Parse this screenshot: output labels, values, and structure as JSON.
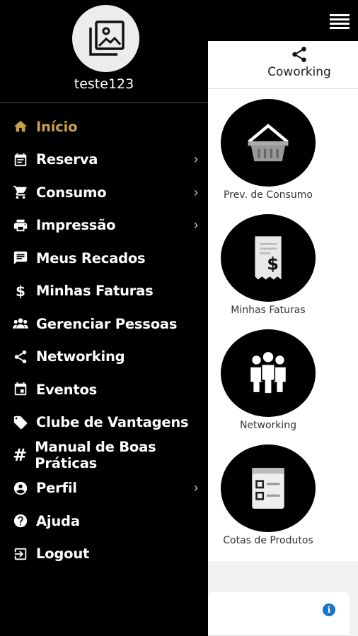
{
  "header": {
    "menu_icon": "hamburger-icon"
  },
  "tabs": {
    "coworking": {
      "label": "Coworking",
      "icon": "share-icon"
    }
  },
  "tiles": [
    {
      "label": "Prev. de Consumo",
      "icon": "basket-icon"
    },
    {
      "label": "Minhas Faturas",
      "icon": "receipt-dollar-icon"
    },
    {
      "label": "Networking",
      "icon": "people-icon"
    },
    {
      "label": "Cotas de Produtos",
      "icon": "checklist-icon"
    }
  ],
  "drawer": {
    "username": "teste123",
    "items": [
      {
        "label": "Início",
        "icon": "home-icon",
        "active": true,
        "submenu": false
      },
      {
        "label": "Reserva",
        "icon": "calendar-icon",
        "submenu": true
      },
      {
        "label": "Consumo",
        "icon": "cart-icon",
        "submenu": true
      },
      {
        "label": "Impressão",
        "icon": "printer-icon",
        "submenu": true
      },
      {
        "label": "Meus Recados",
        "icon": "message-icon",
        "submenu": false
      },
      {
        "label": "Minhas Faturas",
        "icon": "dollar-icon",
        "submenu": false
      },
      {
        "label": "Gerenciar Pessoas",
        "icon": "group-icon",
        "submenu": false
      },
      {
        "label": "Networking",
        "icon": "share-icon",
        "submenu": false
      },
      {
        "label": "Eventos",
        "icon": "event-icon",
        "submenu": false
      },
      {
        "label": "Clube de Vantagens",
        "icon": "tag-icon",
        "submenu": false
      },
      {
        "label": "Manual de Boas Práticas",
        "icon": "hashtag-icon",
        "submenu": false
      },
      {
        "label": "Perfil",
        "icon": "account-icon",
        "submenu": true
      },
      {
        "label": "Ajuda",
        "icon": "help-icon",
        "submenu": false
      },
      {
        "label": "Logout",
        "icon": "logout-icon",
        "submenu": false
      }
    ]
  },
  "colors": {
    "accent": "#c9a24a",
    "drawer_bg": "#000000",
    "info": "#1a73c8"
  }
}
